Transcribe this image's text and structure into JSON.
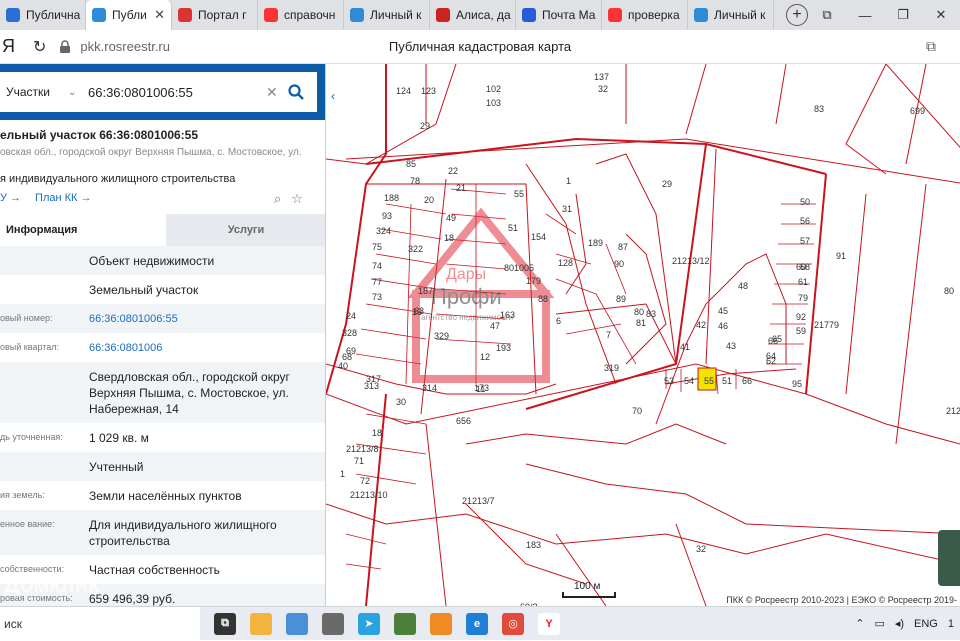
{
  "browser": {
    "tabs": [
      {
        "label": "Публична",
        "icon": "vk-icon",
        "color": "#2a6fd6"
      },
      {
        "label": "Публи",
        "icon": "rosreestr-icon",
        "color": "#2e8bd8",
        "active": true
      },
      {
        "label": "Портал г",
        "icon": "ru-flag-icon",
        "color": "#d33"
      },
      {
        "label": "справочн",
        "icon": "yandex-icon",
        "color": "#f33"
      },
      {
        "label": "Личный к",
        "icon": "rosreestr-icon",
        "color": "#2e8bd8"
      },
      {
        "label": "Алиса, да",
        "icon": "alice-icon",
        "color": "#c22"
      },
      {
        "label": "Почта Ма",
        "icon": "mail-icon",
        "color": "#2a5bd6"
      },
      {
        "label": "проверка",
        "icon": "yandex-icon",
        "color": "#f33"
      },
      {
        "label": "Личный к",
        "icon": "rosreestr-icon",
        "color": "#2e8bd8"
      }
    ],
    "close_glyph": "✕",
    "new_tab": "+",
    "address": "pkk.rosreestr.ru",
    "page_title": "Публичная кадастровая карта",
    "yandex_glyph": "Я"
  },
  "sidebar": {
    "search_type": "Участки",
    "search_value": "66:36:0801006:55",
    "plot_title": "ельный участок 66:36:0801006:55",
    "plot_address": "овская обл., городской округ Верхняя Пышма, с. Мостовское, ул.",
    "plot_use": "я индивидуального жилищного строительства",
    "link_1": "У →",
    "link_2": "План КК →",
    "tab_info": "Информация",
    "tab_services": "Услуги",
    "rows": [
      {
        "k": "",
        "v": "Объект недвижимости",
        "link": false
      },
      {
        "k": "",
        "v": "Земельный участок",
        "link": false
      },
      {
        "k": "овый номер:",
        "v": "66:36:0801006:55",
        "link": true
      },
      {
        "k": "овый квартал:",
        "v": "66:36:0801006",
        "link": true
      },
      {
        "k": "",
        "v": "Свердловская обл., городской округ Верхняя Пышма, с. Мостовское, ул. Набережная, 14",
        "link": false
      },
      {
        "k": "дь уточненная:",
        "v": "1 029 кв. м",
        "link": false
      },
      {
        "k": "",
        "v": "Учтенный",
        "link": false
      },
      {
        "k": "ия земель:",
        "v": "Земли населённых пунктов",
        "link": false
      },
      {
        "k": "енное вание:",
        "v": "Для индивидуального жилищного строительства",
        "link": false
      },
      {
        "k": "собственности:",
        "v": "Частная собственность",
        "link": false
      },
      {
        "k": "ровая стоимость:",
        "v": "659 496,39 руб.",
        "link": false
      }
    ],
    "watermark": "Домклик"
  },
  "map": {
    "labels": [
      "137",
      "32",
      "83",
      "699",
      "124",
      "123",
      "102",
      "29",
      "103",
      "85",
      "22",
      "78",
      "21",
      "55",
      "1",
      "29",
      "50",
      "56",
      "188",
      "20",
      "31",
      "93",
      "49",
      "57",
      "324",
      "51",
      "154",
      "189",
      "87",
      "91",
      "75",
      "322",
      "18",
      "801005",
      "128",
      "90",
      "21213/12",
      "58",
      "74",
      "179",
      "60",
      "80",
      "77",
      "187",
      "61",
      "73",
      "88",
      "89",
      "48",
      "63",
      "79",
      "13",
      "47",
      "80",
      "45",
      "92",
      "21779",
      "24",
      "163",
      "83",
      "42",
      "59",
      "65",
      "66",
      "328",
      "6",
      "81",
      "46",
      "68",
      "69",
      "329",
      "7",
      "43",
      "64",
      "193",
      "41",
      "40",
      "12",
      "319",
      "62",
      "317",
      "313",
      "314",
      "173",
      "53",
      "54",
      "55",
      "51",
      "66",
      "95",
      "30",
      "11",
      "70",
      "21213/11",
      "656",
      "18",
      "21213/8",
      "71",
      "1",
      "72",
      "21213/7",
      "21213/10",
      "183",
      "32",
      "69/2",
      "21213/14",
      "801006"
    ],
    "scale": "100 м",
    "credit": "ПКК © Росреестр 2010-2023 | ЕЭКО © Росреестр 2019-",
    "watermark_1": "Дары",
    "watermark_2": "Профи",
    "watermark_3": "агентство недвижимости"
  },
  "taskbar": {
    "search": "иск",
    "lang": "ENG",
    "time": "1"
  }
}
